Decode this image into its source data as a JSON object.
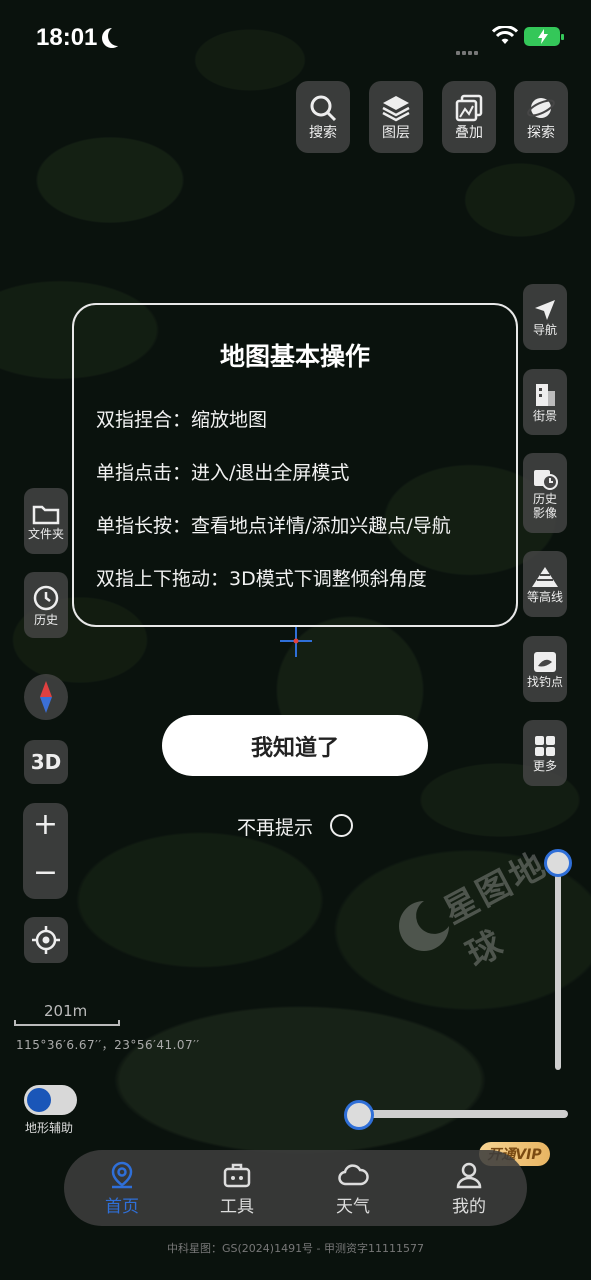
{
  "status_bar": {
    "time": "18:01"
  },
  "top_tools": [
    {
      "label": "搜索",
      "icon": "search-icon"
    },
    {
      "label": "图层",
      "icon": "layers-icon"
    },
    {
      "label": "叠加",
      "icon": "overlay-icon"
    },
    {
      "label": "探索",
      "icon": "planet-icon"
    }
  ],
  "right_tools": [
    {
      "label": "导航",
      "icon": "navigation-arrow-icon"
    },
    {
      "label": "街景",
      "icon": "building-icon"
    },
    {
      "label": "历史\n影像",
      "icon": "history-image-icon"
    },
    {
      "label": "等高线",
      "icon": "contour-icon"
    },
    {
      "label": "找钓点",
      "icon": "fishing-icon"
    },
    {
      "label": "更多",
      "icon": "grid-icon"
    }
  ],
  "left_tools": [
    {
      "label": "文件夹",
      "icon": "folder-icon"
    },
    {
      "label": "历史",
      "icon": "clock-icon"
    }
  ],
  "view_3d_label": "3D",
  "dialog": {
    "title": "地图基本操作",
    "lines": [
      "双指捏合：缩放地图",
      "单指点击：进入/退出全屏模式",
      "单指长按：查看地点详情/添加兴趣点/导航",
      "双指上下拖动：3D模式下调整倾斜角度"
    ],
    "ok_label": "我知道了",
    "no_remind_label": "不再提示"
  },
  "zoom": {
    "in": "+",
    "out": "−"
  },
  "scale": {
    "label": "201m"
  },
  "coordinates": "115°36′6.67′′，23°56′41.07′′",
  "terrain_toggle": {
    "label": "地形辅助",
    "on": true
  },
  "watermark": "星图地球",
  "vip_badge": "开通VIP",
  "nav": [
    {
      "label": "首页",
      "icon": "location-pin-icon",
      "active": true
    },
    {
      "label": "工具",
      "icon": "toolbox-icon",
      "active": false
    },
    {
      "label": "天气",
      "icon": "cloud-icon",
      "active": false
    },
    {
      "label": "我的",
      "icon": "user-icon",
      "active": false
    }
  ],
  "footer": "中科星图：GS(2024)1491号 - 甲测资字11111577",
  "colors": {
    "accent": "#2f6fd8",
    "battery": "#34c759",
    "vip": "#e8b563"
  }
}
